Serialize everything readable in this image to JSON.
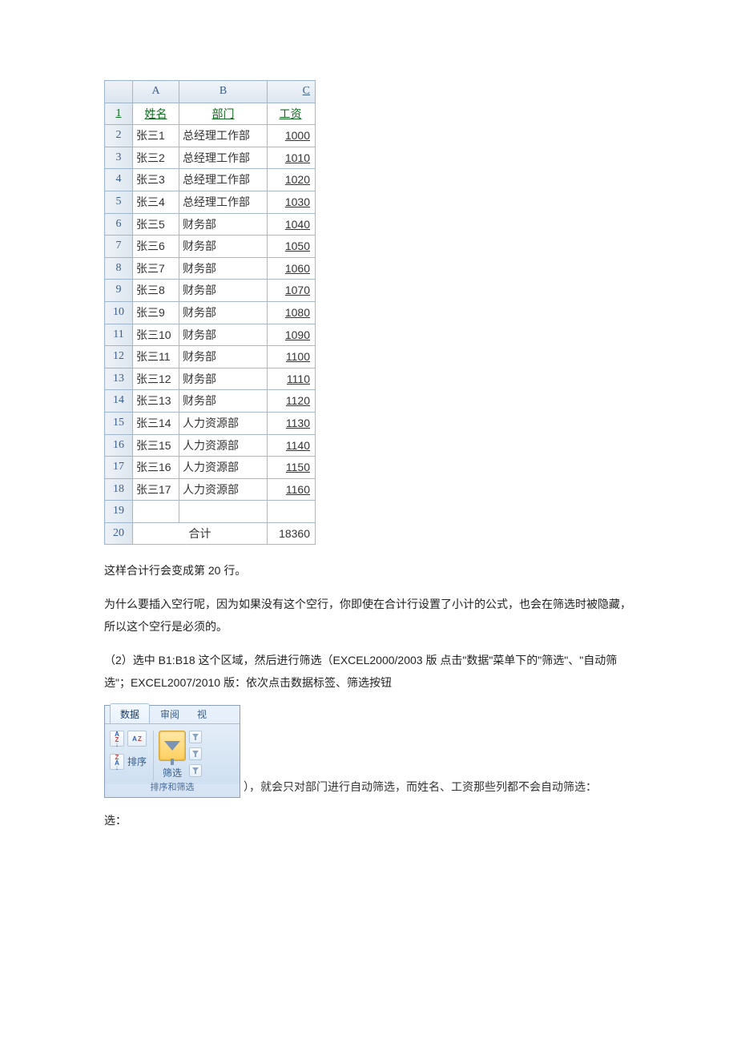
{
  "spreadsheet": {
    "columns": [
      "A",
      "B",
      "C"
    ],
    "header_row": {
      "num": "1",
      "a": "姓名",
      "b": "部门",
      "c": "工资"
    },
    "rows": [
      {
        "num": "2",
        "a": "张三1",
        "b": "总经理工作部",
        "c": "1000"
      },
      {
        "num": "3",
        "a": "张三2",
        "b": "总经理工作部",
        "c": "1010"
      },
      {
        "num": "4",
        "a": "张三3",
        "b": "总经理工作部",
        "c": "1020"
      },
      {
        "num": "5",
        "a": "张三4",
        "b": "总经理工作部",
        "c": "1030"
      },
      {
        "num": "6",
        "a": "张三5",
        "b": "财务部",
        "c": "1040"
      },
      {
        "num": "7",
        "a": "张三6",
        "b": "财务部",
        "c": "1050"
      },
      {
        "num": "8",
        "a": "张三7",
        "b": "财务部",
        "c": "1060"
      },
      {
        "num": "9",
        "a": "张三8",
        "b": "财务部",
        "c": "1070"
      },
      {
        "num": "10",
        "a": "张三9",
        "b": "财务部",
        "c": "1080"
      },
      {
        "num": "11",
        "a": "张三10",
        "b": "财务部",
        "c": "1090"
      },
      {
        "num": "12",
        "a": "张三11",
        "b": "财务部",
        "c": "1100"
      },
      {
        "num": "13",
        "a": "张三12",
        "b": "财务部",
        "c": "1110"
      },
      {
        "num": "14",
        "a": "张三13",
        "b": "财务部",
        "c": "1120"
      },
      {
        "num": "15",
        "a": "张三14",
        "b": "人力资源部",
        "c": "1130"
      },
      {
        "num": "16",
        "a": "张三15",
        "b": "人力资源部",
        "c": "1140"
      },
      {
        "num": "17",
        "a": "张三16",
        "b": "人力资源部",
        "c": "1150"
      },
      {
        "num": "18",
        "a": "张三17",
        "b": "人力资源部",
        "c": "1160"
      }
    ],
    "blank_row_num": "19",
    "total_row": {
      "num": "20",
      "label": "合计",
      "value": "18360"
    }
  },
  "paragraphs": {
    "p1": "这样合计行会变成第 20 行。",
    "p2": "为什么要插入空行呢，因为如果没有这个空行，你即使在合计行设置了小计的公式，也会在筛选时被隐藏，所以这个空行是必须的。",
    "p3_a": "（2）选中 B1:B18 这个区域，然后进行筛选（EXCEL2000/2003 版 点击\"数据\"菜单下的\"筛选\"、\"自动筛选\"；EXCEL2007/2010 版：依次点击数据标签、筛选按钮",
    "p3_b": "），就会只对部门进行自动筛选，而姓名、工资那些列都不会自动筛选：",
    "p4": "选："
  },
  "ribbon": {
    "tabs": {
      "data": "数据",
      "review": "审阅",
      "view_partial": "视"
    },
    "sort_label": "排序",
    "filter_label": "筛选",
    "group_label": "排序和筛选"
  }
}
